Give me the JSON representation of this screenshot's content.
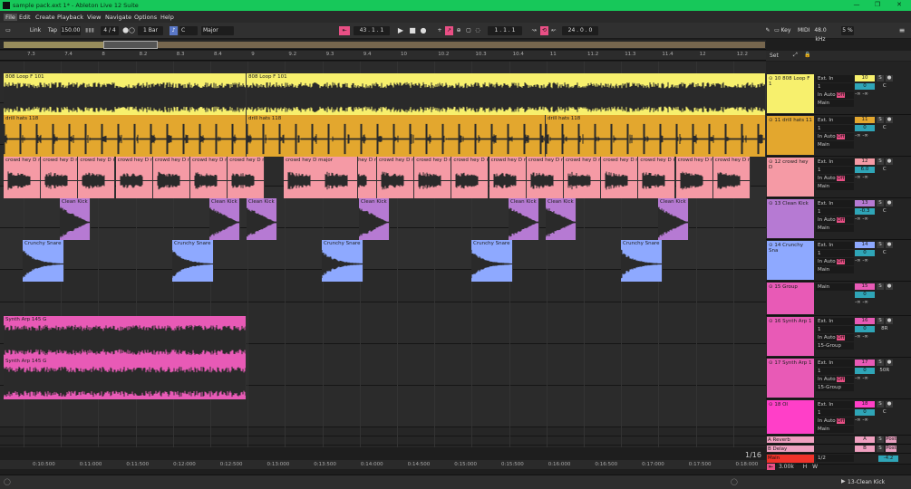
{
  "window": {
    "title": "sample pack.ext 1* - Ableton Live 12 Suite",
    "min": "—",
    "max": "❐",
    "close": "✕"
  },
  "menu": [
    "File",
    "Edit",
    "Create",
    "Playback",
    "View",
    "Navigate",
    "Options",
    "Help"
  ],
  "transport": {
    "link": "Link",
    "tap": "Tap",
    "tempo": "150.00",
    "signature": "4 / 4",
    "quant": "1 Bar",
    "key": "C",
    "scale": "Major",
    "position": "43 .  1 .  1",
    "loop_start": "1 .  1 .  1",
    "loop_len": "24 .  0 .  0",
    "key_btn": "Key",
    "midi_label": "MIDI",
    "sample_rate": "48.0 kHz",
    "cpu": "5 %"
  },
  "ruler": {
    "ticks": [
      "7.3",
      "7.4",
      "8",
      "8.2",
      "8.3",
      "8.4",
      "9",
      "9.2",
      "9.3",
      "9.4",
      "10",
      "10.2",
      "10.3",
      "10.4",
      "11",
      "11.2",
      "11.3",
      "11.4",
      "12",
      "12.2"
    ]
  },
  "set_label": "Set",
  "time_ticks": [
    "0:10:500",
    "0:11:000",
    "0:11:500",
    "0:12:000",
    "0:12:500",
    "0:13:000",
    "0:13:500",
    "0:14:000",
    "0:14:500",
    "0:15:000",
    "0:15:500",
    "0:16:000",
    "0:16:500",
    "0:17:000",
    "0:17:500",
    "0:18:000"
  ],
  "zoom": "1/16",
  "tracks": [
    {
      "num": "10",
      "name": "10 808 Loop F 1",
      "input": "Ext. In",
      "ch": "1",
      "mon": [
        "In",
        "Auto",
        "Off"
      ],
      "out": "Main",
      "vol": "0",
      "pan": "C",
      "color": "#f7f06d"
    },
    {
      "num": "11",
      "name": "11 drill hats 11",
      "input": "Ext. In",
      "ch": "1",
      "mon": [
        "In",
        "Auto",
        "Off"
      ],
      "out": "Main",
      "vol": "0",
      "pan": "C",
      "color": "#e3a72e"
    },
    {
      "num": "12",
      "name": "12 crowd hey D",
      "input": "Ext. In",
      "ch": "1",
      "mon": [
        "In",
        "Auto",
        "Off"
      ],
      "out": "Main",
      "vol": "6.0",
      "pan": "C",
      "color": "#f59aa5"
    },
    {
      "num": "13",
      "name": "13 Clean Kick",
      "input": "Ext. In",
      "ch": "1",
      "mon": [
        "In",
        "Auto",
        "Off"
      ],
      "out": "Main",
      "vol": "-0.3",
      "pan": "C",
      "color": "#b67ad3"
    },
    {
      "num": "14",
      "name": "14 Crunchy Sna",
      "input": "Ext. In",
      "ch": "1",
      "mon": [
        "In",
        "Auto",
        "Off"
      ],
      "out": "Main",
      "vol": "0",
      "pan": "C",
      "color": "#8ea9ff"
    },
    {
      "num": "15",
      "name": "15 Group",
      "input": "Main",
      "ch": "",
      "mon": [],
      "out": "",
      "vol": "0",
      "pan": "",
      "color": "#e85ab6"
    },
    {
      "num": "16",
      "name": "16 Synth Arp 1",
      "input": "Ext. In",
      "ch": "1",
      "mon": [
        "In",
        "Auto",
        "Off"
      ],
      "out": "15-Group",
      "vol": "0",
      "pan": "8R",
      "color": "#e85ab6"
    },
    {
      "num": "17",
      "name": "17 Synth Arp 1",
      "input": "Ext. In",
      "ch": "1",
      "mon": [
        "In",
        "Auto",
        "Off"
      ],
      "out": "15-Group",
      "vol": "0",
      "pan": "50R",
      "color": "#e85ab6"
    },
    {
      "num": "18",
      "name": "18 OI",
      "input": "Ext. In",
      "ch": "1",
      "mon": [
        "In",
        "Auto",
        "Off"
      ],
      "out": "Main",
      "vol": "0",
      "pan": "C",
      "color": "#ff3fc8"
    }
  ],
  "returns": [
    {
      "name": "A Reverb",
      "letter": "A",
      "post": "Post",
      "color": "#f0a0c0"
    },
    {
      "name": "B Delay",
      "letter": "B",
      "post": "Post",
      "color": "#f0a0c0"
    }
  ],
  "master": {
    "name": "Main",
    "io": "1/2",
    "vol": "-4.2",
    "color": "#f0322a"
  },
  "clips": {
    "c808a": "808 Loop F 101",
    "c808b": "808 Loop F 101",
    "hats": "drill hats 118",
    "crowd": "crowd hey D ma",
    "crowd_major": "crowd hey D major",
    "kick": "Clean Kick",
    "snare": "Crunchy Snare",
    "synth1": "Synth Arp 145 G",
    "synth2": "Synth Arp 145 G"
  },
  "bottom": {
    "tempo_field": "3.00k",
    "h": "H",
    "w": "W",
    "status_track": "13-Clean Kick"
  }
}
